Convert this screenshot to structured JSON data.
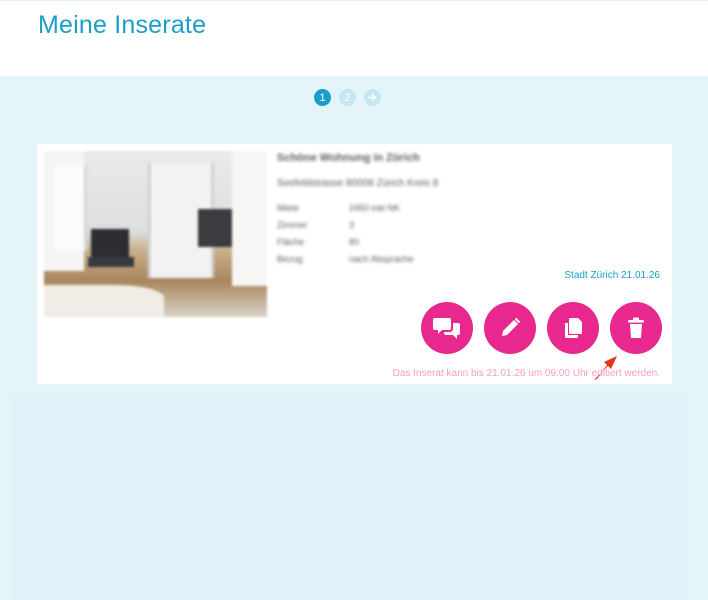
{
  "header": {
    "title": "Meine Inserate"
  },
  "pagination": {
    "pages": [
      "1",
      "2"
    ],
    "active": "1",
    "next_icon": "arrow-right-icon"
  },
  "listing": {
    "title": "Schöne Wohnung in Zürich",
    "address": "Seefeldstrasse 80008 Zürich Kreis 8",
    "details": [
      {
        "key": "Miete",
        "value": "2450 inkl NK"
      },
      {
        "key": "Zimmer",
        "value": "3"
      },
      {
        "key": "Fläche",
        "value": "80"
      },
      {
        "key": "Bezug",
        "value": "nach Absprache"
      }
    ],
    "date_line": "Stadt Zürich 21.01.26",
    "note": "Das Inserat kann bis 21.01.26 um 09:00 Uhr editiert werden.",
    "actions": [
      {
        "icon": "chat-bubbles-icon"
      },
      {
        "icon": "pencil-icon"
      },
      {
        "icon": "copy-icon"
      },
      {
        "icon": "trash-icon"
      }
    ]
  },
  "colors": {
    "accent": "#1a9ec9",
    "button": "#e8288f",
    "background": "#e4f5fa",
    "arrow": "#e23418"
  }
}
